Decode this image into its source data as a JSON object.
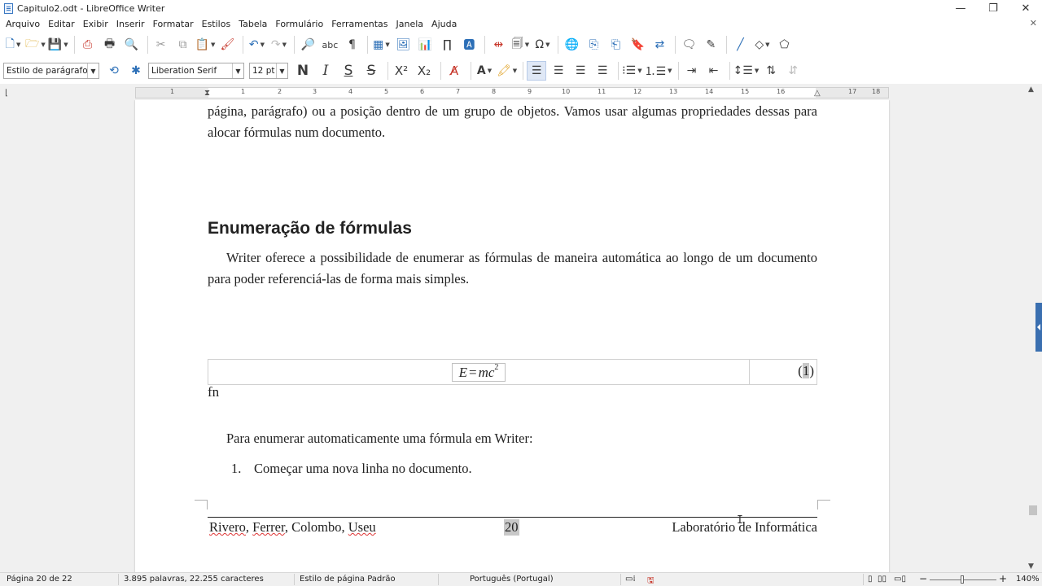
{
  "window": {
    "title": "Capitulo2.odt - LibreOffice Writer",
    "minimize": "—",
    "maximize": "❐",
    "close": "✕"
  },
  "menubar": {
    "items": [
      {
        "label": "Arquivo"
      },
      {
        "label": "Editar"
      },
      {
        "label": "Exibir"
      },
      {
        "label": "Inserir"
      },
      {
        "label": "Formatar"
      },
      {
        "label": "Estilos"
      },
      {
        "label": "Tabela"
      },
      {
        "label": "Formulário"
      },
      {
        "label": "Ferramentas"
      },
      {
        "label": "Janela"
      },
      {
        "label": "Ajuda"
      }
    ],
    "close_doc": "✕"
  },
  "formatting": {
    "paragraph_style": "Estilo de parágrafo Padrão",
    "font_name": "Liberation Serif",
    "font_size": "12 pt",
    "bold": "N",
    "italic": "I",
    "underline": "S",
    "strike": "S"
  },
  "ruler": {
    "numbers": [
      "1",
      "1",
      "2",
      "3",
      "4",
      "5",
      "6",
      "7",
      "8",
      "9",
      "10",
      "11",
      "12",
      "13",
      "14",
      "15",
      "16",
      "17",
      "18"
    ]
  },
  "document": {
    "p1": "página, parágrafo) ou a posição dentro de um grupo de objetos. Vamos usar algumas propriedades dessas para alocar fórmulas num documento.",
    "heading": "Enumeração de fórmulas",
    "p2": "Writer oferece a possibilidade de enumerar as fórmulas de maneira automática ao longo de um documento para poder referenciá-las de forma mais simples.",
    "formula_lhs": "E",
    "formula_eq": "=",
    "formula_rhs": "mc",
    "formula_exp": "2",
    "formula_number_open": "(",
    "formula_number": "1",
    "formula_number_close": ")",
    "fn": "fn",
    "p3": "Para enumerar automaticamente uma fórmula em Writer:",
    "list_number": "1.",
    "list_item": "Começar uma nova linha no documento."
  },
  "footer": {
    "authors_a": "Rivero",
    "authors_sep1": ", ",
    "authors_b": "Ferrer",
    "authors_sep2": ", Colombo, ",
    "authors_c": "Useu",
    "page_number": "20",
    "lab": "Laboratório de Informática"
  },
  "statusbar": {
    "page": "Página 20 de 22",
    "words": "3.895 palavras, 22.255 caracteres",
    "page_style": "Estilo de página Padrão",
    "language": "Português (Portugal)",
    "zoom": "140%",
    "zoom_minus": "−",
    "zoom_plus": "+"
  },
  "colors": {
    "accent": "#3a6fb0",
    "field_shading": "#c8c8c8"
  }
}
